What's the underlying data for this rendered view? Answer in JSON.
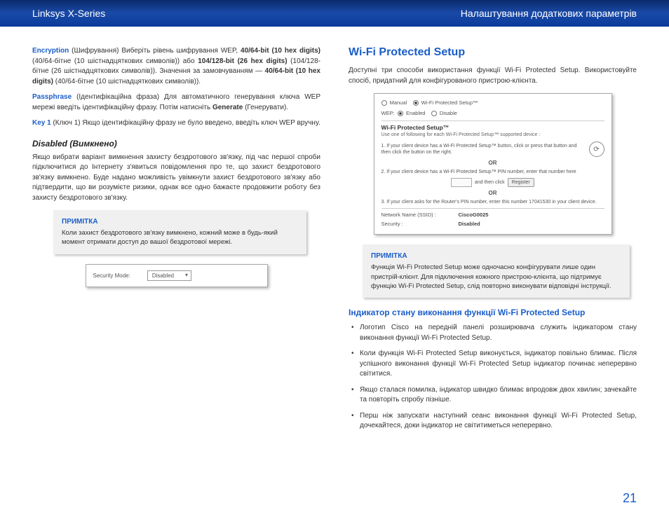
{
  "header": {
    "left": "Linksys X-Series",
    "right": "Налаштування додаткових параметрів"
  },
  "left_col": {
    "encryption": {
      "label": "Encryption",
      "p1a": " (Шифрування) Виберіть рівень шифрування WEP, ",
      "b1": "40/64-bit (10 hex digits)",
      "p1b": " (40/64-бітне (10 шістнадцяткових символів)) або ",
      "b2": "104/128-bit (26 hex digits)",
      "p1c": " (104/128-бітне (26 шістнадцяткових символів)). Значення за замовчуванням — ",
      "b3": "40/64-bit (10 hex digits)",
      "p1d": " (40/64-бітне (10 шістнадцяткових символів))."
    },
    "passphrase": {
      "label": "Passphrase",
      "p1a": " (Ідентифікаційна фраза) Для автоматичного генерування ключа WEP мережі введіть ідентифікаційну фразу. Потім натисніть ",
      "b1": "Generate",
      "p1b": " (Генерувати)."
    },
    "key1": {
      "label": "Key 1",
      "p1": " (Ключ 1)  Якщо ідентифікаційну фразу не було введено, введіть ключ WEP вручну."
    },
    "disabled_heading": "Disabled (Вимкнено)",
    "disabled_p": "Якщо вибрати варіант вимкнення захисту бездротового зв'язку, під час першої спроби підключитися до Інтернету з'явиться повідомлення про те, що захист бездротового зв'язку вимкнено. Буде надано можливість увімкнути захист бездротового зв'язку або підтвердити, що ви розумієте ризики, однак все одно бажаєте продовжити роботу без захисту бездротового зв'язку.",
    "note": {
      "title": "ПРИМІТКА",
      "text": "Коли захист бездротового зв'язку вимкнено, кожний може в будь-який момент отримати доступ до вашої бездротової мережі."
    },
    "secmode": {
      "label": "Security Mode:",
      "value": "Disabled"
    }
  },
  "right_col": {
    "h2": "Wi-Fi Protected Setup",
    "intro": "Доступні три способи використання функції Wi-Fi Protected Setup. Використовуйте спосіб, придатний для конфігурованого пристрою-клієнта.",
    "wps_ss": {
      "manual": "Manual",
      "wps": "Wi-Fi Protected Setup™",
      "wep_label": "WEP:",
      "enabled": "Enabled",
      "disable": "Disable",
      "title": "Wi-Fi Protected Setup™",
      "sub": "Use one of following for each Wi-Fi Protected Setup™ supported device :",
      "step1": "1. If your client device has a Wi-Fi Protected Setup™ button, click or press that button and then click the button on the right.",
      "or": "OR",
      "step2": "2. If your client device has a Wi-Fi Protected Setup™ PIN number, enter that number here",
      "register": "Register",
      "andclick": "and then click",
      "step3": "3. If your client asks for the Router's PIN number, enter this number 17041530 in your client device.",
      "ssid_k": "Network Name (SSID) :",
      "ssid_v": "CiscoG0025",
      "sec_k": "Security :",
      "sec_v": "Disabled"
    },
    "note": {
      "title": "ПРИМІТКА",
      "text": "Функція Wi-Fi Protected Setup може одночасно конфігурувати лише один пристрій-клієнт. Для підключення кожного пристрою-клієнта, що підтримує функцію Wi-Fi Protected Setup, слід повторно виконувати відповідні інструкції."
    },
    "h3": "Індикатор стану виконання функції Wi-Fi Protected Setup",
    "bullets": [
      "Логотип Cisco на передній панелі розширювача служить індикатором стану виконання функції Wi-Fi Protected Setup.",
      "Коли функція Wi-Fi Protected Setup виконується, індикатор повільно блимає. Після успішного виконання функції Wi-Fi Protected Setup індикатор починає неперервно світитися.",
      "Якщо сталася помилка, індикатор швидко блимає впродовж двох хвилин; зачекайте та повторіть спробу пізніше.",
      "Перш ніж запускати наступний сеанс виконання функції Wi-Fi Protected Setup, дочекайтеся, доки індикатор не світитиметься неперервно."
    ]
  },
  "page_number": "21"
}
